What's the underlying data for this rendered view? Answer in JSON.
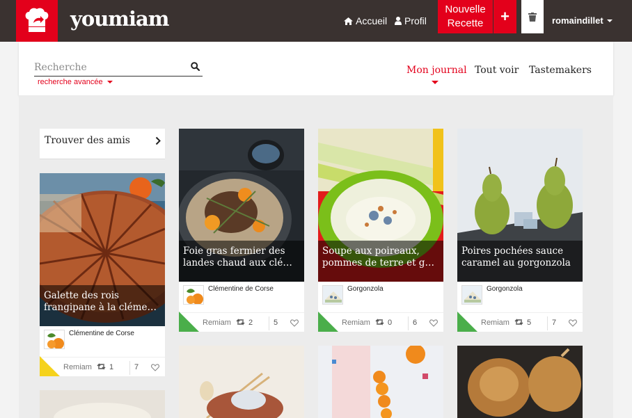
{
  "app": {
    "brand": "youmiam",
    "colors": {
      "brand_red": "#e3001b",
      "topbar": "#3a3230",
      "green": "#4aae4a",
      "yellow": "#f5d21c"
    }
  },
  "topnav": {
    "home_label": "Accueil",
    "home_icon": "home-icon",
    "profile_label": "Profil",
    "profile_icon": "user-icon",
    "new_recipe_line1": "Nouvelle",
    "new_recipe_line2": "Recette",
    "plus_label": "+",
    "trash_icon": "trash-icon",
    "username": "romaindillet"
  },
  "subnav": {
    "search_placeholder": "Recherche",
    "advanced_search": "recherche avancée",
    "tabs": [
      {
        "label": "Mon journal",
        "active": true
      },
      {
        "label": "Tout voir",
        "active": false
      },
      {
        "label": "Tastemakers",
        "active": false
      }
    ]
  },
  "sidebar": {
    "find_friends": "Trouver des amis"
  },
  "cards": [
    {
      "title_line1": "Galette des rois",
      "title_line2": "frangipane à la clément...",
      "ingredient": "Clémentine de Corse",
      "remiam": "Remiam",
      "reposts": "1",
      "likes": "7",
      "badge": "yellow"
    },
    {
      "title_line1": "Foie gras fermier des",
      "title_line2": "landes chaud aux cléme...",
      "ingredient": "Clémentine de Corse",
      "remiam": "Remiam",
      "reposts": "2",
      "likes": "5",
      "badge": "green"
    },
    {
      "title_line1": "Soupe aux poireaux,",
      "title_line2": "pommes de terre et gorg...",
      "ingredient": "Gorgonzola",
      "remiam": "Remiam",
      "reposts": "0",
      "likes": "6",
      "badge": "green"
    },
    {
      "title_line1": "Poires pochées sauce",
      "title_line2": "caramel au gorgonzola",
      "ingredient": "Gorgonzola",
      "remiam": "Remiam",
      "reposts": "5",
      "likes": "7",
      "badge": "green"
    }
  ]
}
